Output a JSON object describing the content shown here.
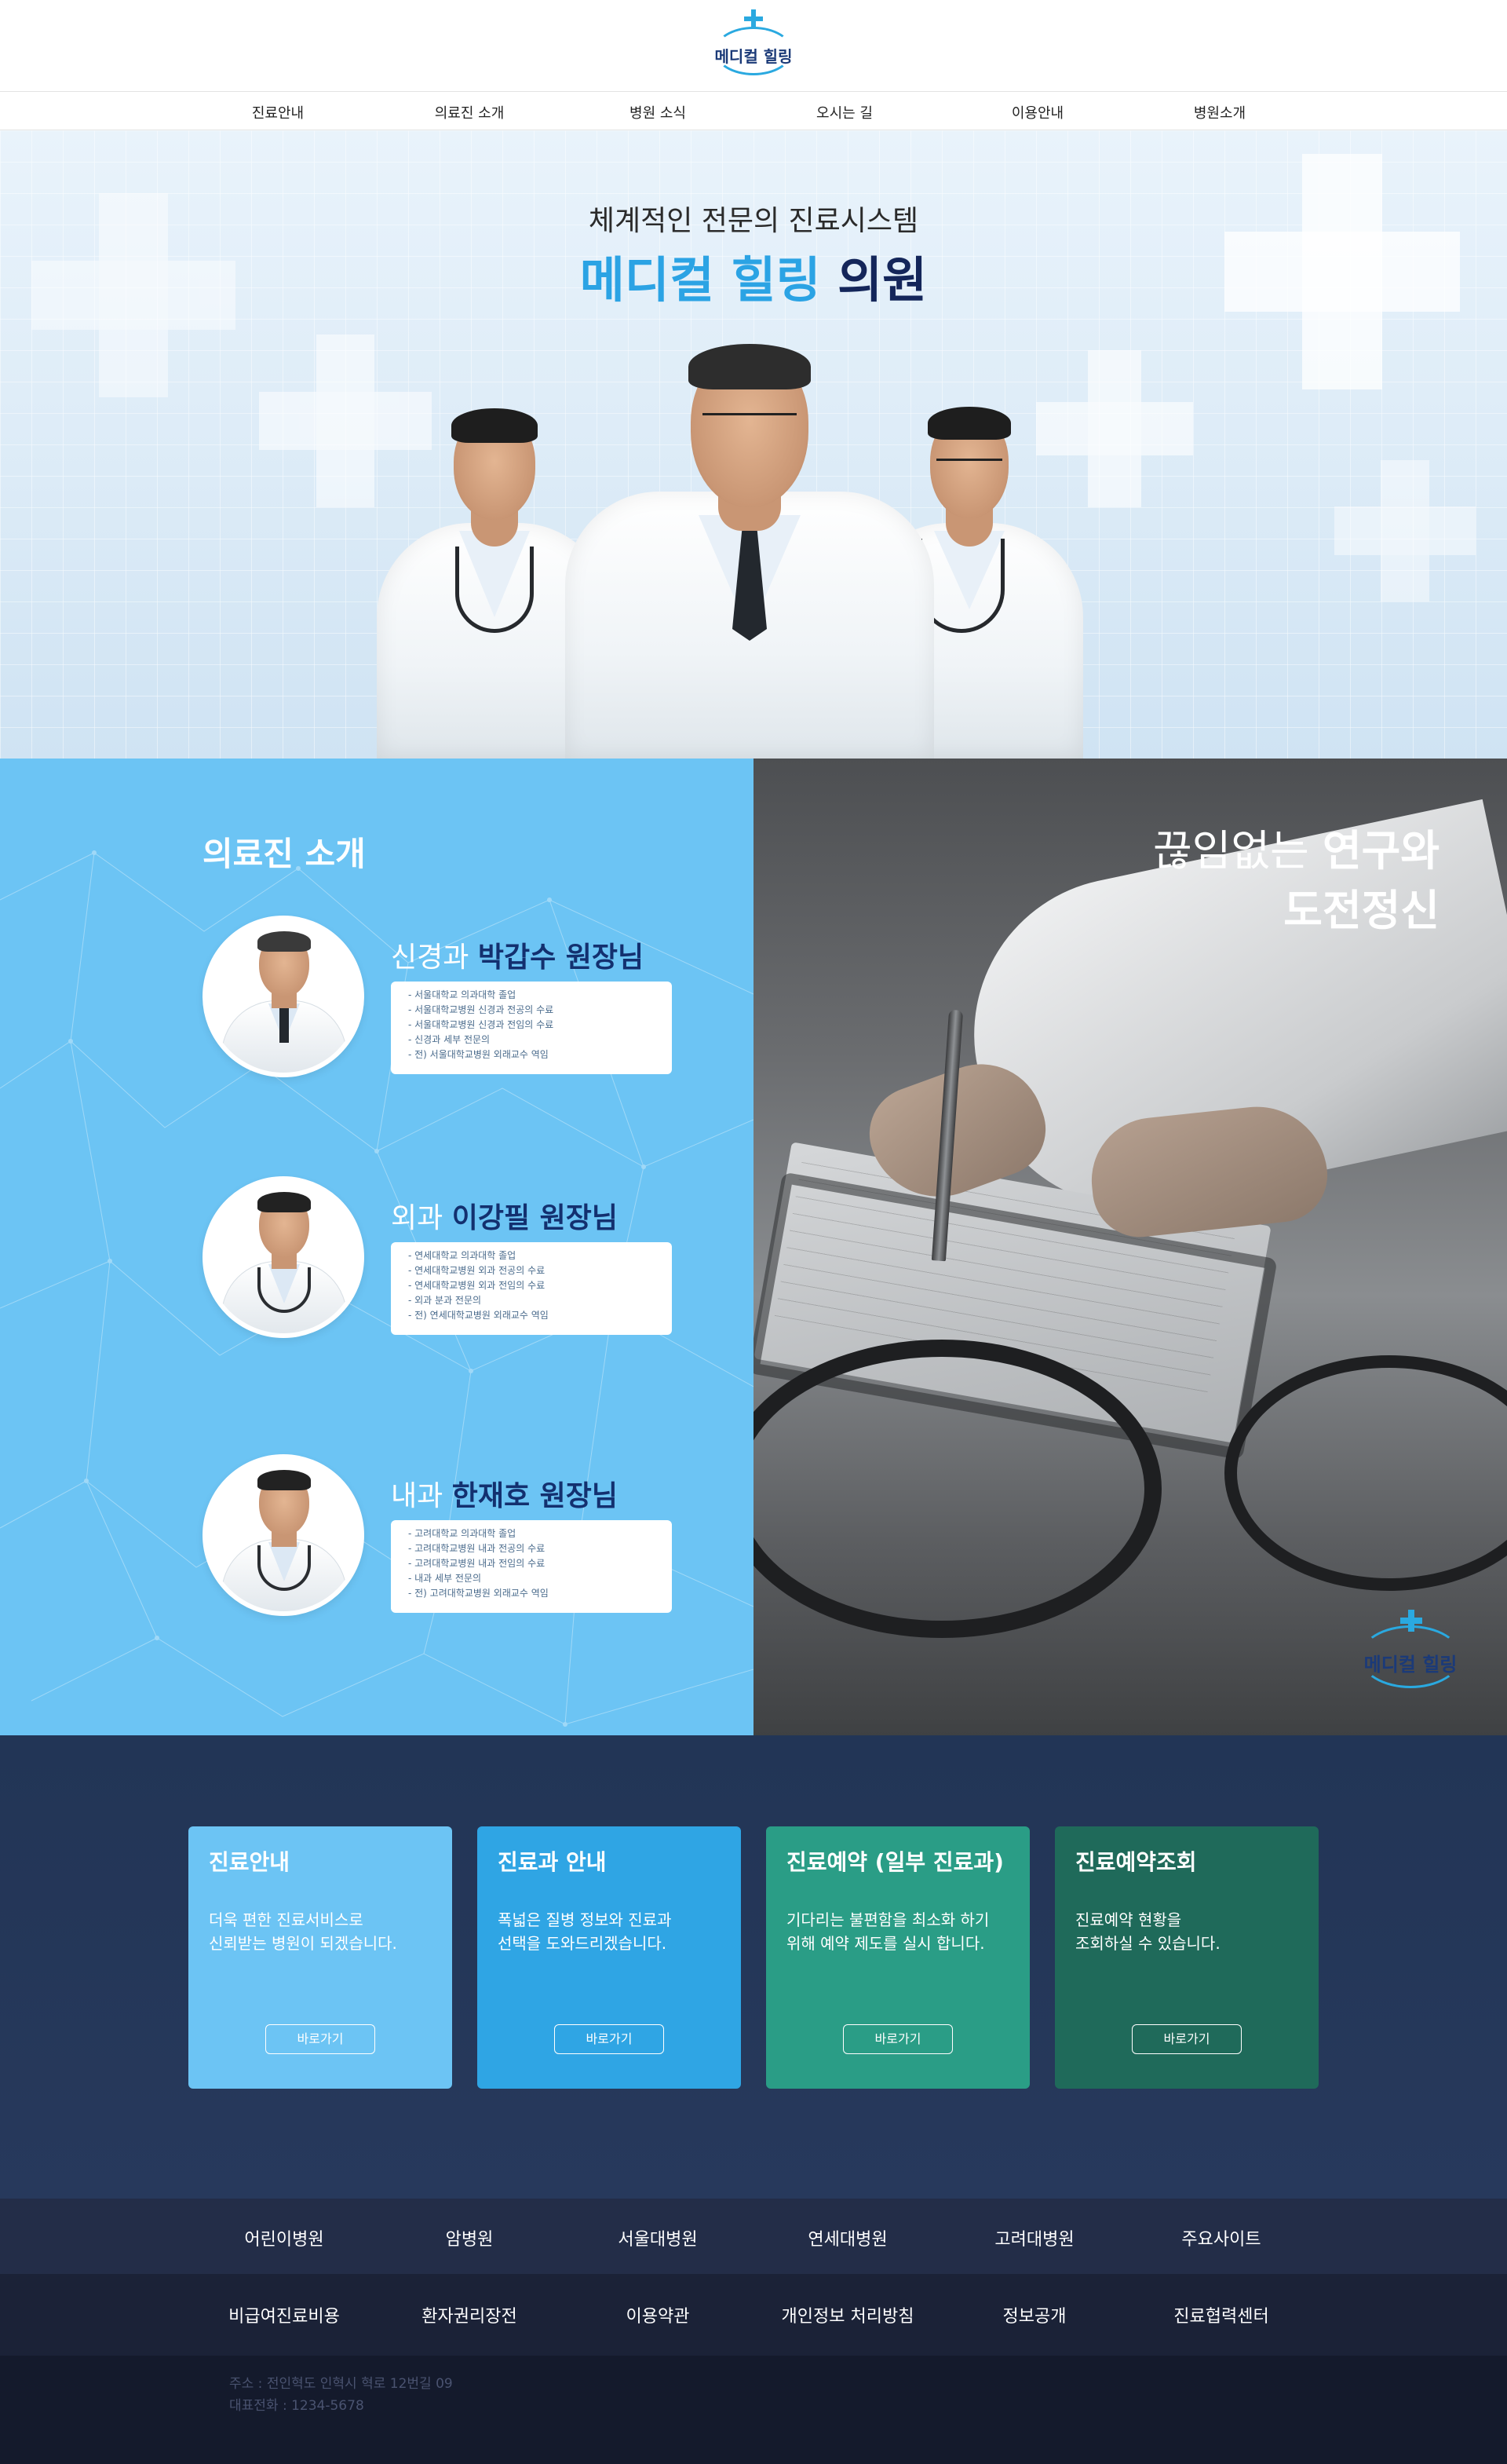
{
  "header": {
    "logo_text": "메디컬 힐링",
    "nav": [
      "진료안내",
      "의료진 소개",
      "병원 소식",
      "오시는 길",
      "이용안내",
      "병원소개"
    ]
  },
  "hero": {
    "subtitle": "체계적인 전문의 진료시스템",
    "title_accent": "메디컬 힐링",
    "title_main": "의원"
  },
  "staff": {
    "title": "의료진 소개",
    "doctors": [
      {
        "dept": "신경과",
        "name": "박갑수 원장님",
        "bio": [
          "- 서울대학교 의과대학 졸업",
          "- 서울대학교병원 신경과 전공의 수료",
          "- 서울대학교병원 신경과 전임의 수료",
          "- 신경과 세부 전문의",
          "- 전) 서울대학교병원 외래교수 역임"
        ]
      },
      {
        "dept": "외과",
        "name": "이강필 원장님",
        "bio": [
          "- 연세대학교 의과대학 졸업",
          "- 연세대학교병원 외과 전공의 수료",
          "- 연세대학교병원 외과 전임의 수료",
          "- 외과 분과 전문의",
          "- 전) 연세대학교병원 외래교수 역임"
        ]
      },
      {
        "dept": "내과",
        "name": "한재호 원장님",
        "bio": [
          "- 고려대학교 의과대학 졸업",
          "- 고려대학교병원 내과 전공의 수료",
          "- 고려대학교병원 내과 전임의 수료",
          "- 내과 세부 전문의",
          "- 전) 고려대학교병원 외래교수 역임"
        ]
      }
    ]
  },
  "research": {
    "line1_light": "끊임없는",
    "line1_bold": "연구와",
    "line2_bold": "도전정신",
    "logo_text": "메디컬 힐링"
  },
  "services": [
    {
      "title": "진료안내",
      "desc": "더욱 편한 진료서비스로\n신뢰받는 병원이 되겠습니다.",
      "button": "바로가기",
      "color": "#6cc4f4"
    },
    {
      "title": "진료과 안내",
      "desc": "폭넓은 질병 정보와 진료과\n선택을 도와드리겠습니다.",
      "button": "바로가기",
      "color": "#2fa5e4"
    },
    {
      "title": "진료예약 (일부 진료과)",
      "desc": "기다리는 불편함을 최소화 하기\n위해 예약 제도를 실시 합니다.",
      "button": "바로가기",
      "color": "#2a9d86"
    },
    {
      "title": "진료예약조회",
      "desc": "진료예약 현황을\n조회하실 수 있습니다.",
      "button": "바로가기",
      "color": "#1f6a5a"
    }
  ],
  "footer": {
    "sites": [
      "어린이병원",
      "암병원",
      "서울대병원",
      "연세대병원",
      "고려대병원",
      "주요사이트"
    ],
    "links": [
      "비급여진료비용",
      "환자권리장전",
      "이용약관",
      "개인정보 처리방침",
      "정보공개",
      "진료협력센터"
    ],
    "address": "주소 : 전인혁도 인혁시 혁로 12번길 09",
    "phone": "대표전화 : 1234-5678"
  }
}
